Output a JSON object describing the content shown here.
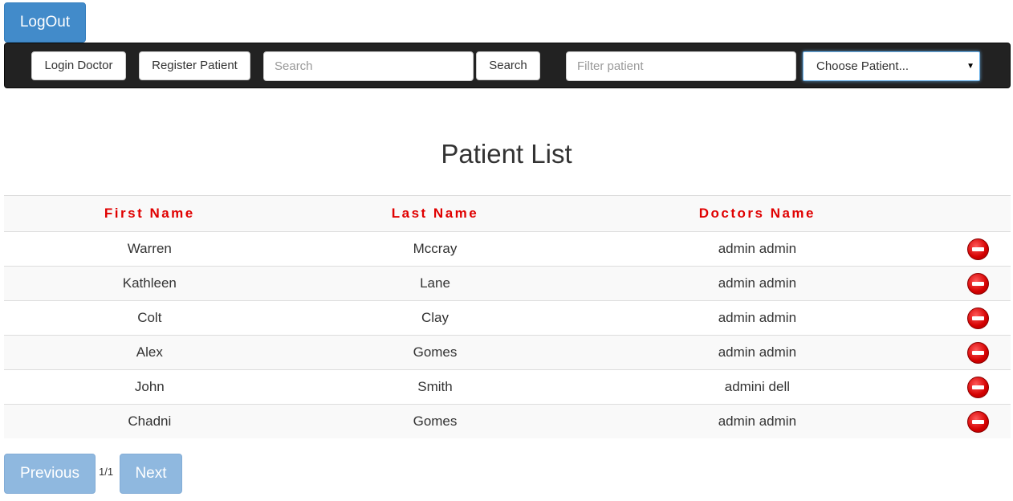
{
  "header": {
    "logout_label": "LogOut"
  },
  "navbar": {
    "login_doctor_label": "Login Doctor",
    "register_patient_label": "Register Patient",
    "search_placeholder": "Search",
    "search_button_label": "Search",
    "filter_placeholder": "Filter patient",
    "choose_patient_selected": "Choose Patient..."
  },
  "page": {
    "title": "Patient List"
  },
  "table": {
    "headers": [
      "First Name",
      "Last Name",
      "Doctors Name"
    ],
    "rows": [
      {
        "first": "Warren",
        "last": "Mccray",
        "doctor": "admin admin"
      },
      {
        "first": "Kathleen",
        "last": "Lane",
        "doctor": "admin admin"
      },
      {
        "first": "Colt",
        "last": "Clay",
        "doctor": "admin admin"
      },
      {
        "first": "Alex",
        "last": "Gomes",
        "doctor": "admin admin"
      },
      {
        "first": "John",
        "last": "Smith",
        "doctor": "admini dell"
      },
      {
        "first": "Chadni",
        "last": "Gomes",
        "doctor": "admin admin"
      }
    ],
    "delete_icon": "delete-icon"
  },
  "pagination": {
    "previous_label": "Previous",
    "indicator": "1/1",
    "next_label": "Next"
  },
  "colors": {
    "primary": "#428bca",
    "header_text": "#e00000",
    "navbar_bg": "#222222",
    "pager_disabled": "#8fb8df"
  }
}
